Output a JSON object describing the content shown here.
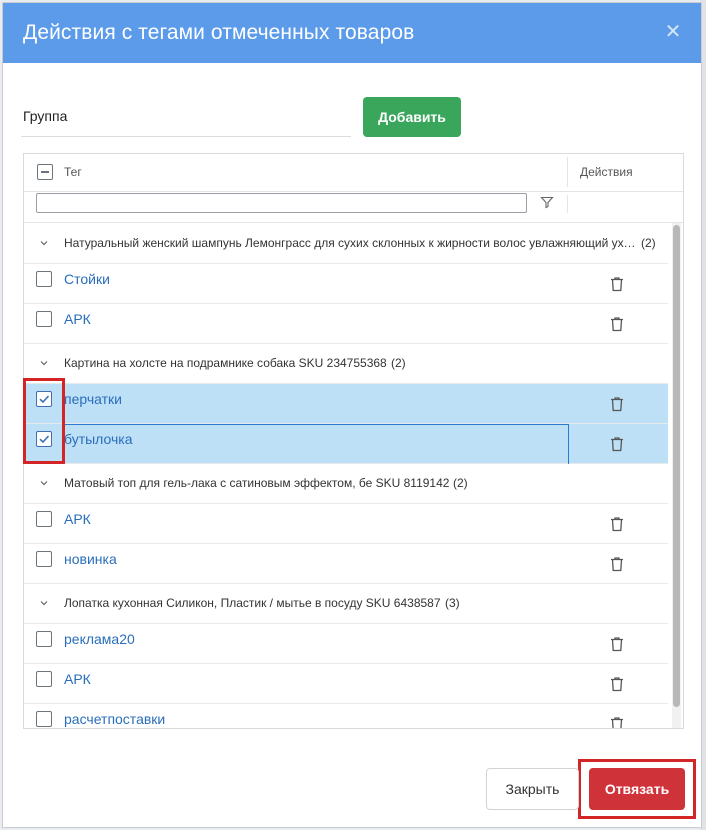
{
  "dialog": {
    "title": "Действия с тегами отмеченных товаров",
    "close_icon": "close-icon"
  },
  "group_input": {
    "value": "Группа",
    "placeholder": ""
  },
  "add_button": "Добавить",
  "table": {
    "header_tag": "Тег",
    "header_actions": "Действия",
    "filter_value": "",
    "groups": [
      {
        "title": "Натуральный женский шампунь Лемонграсс для сухих склонных к жирности волос увлажняющий ухо…",
        "count": "(2)",
        "rows": [
          {
            "tag": "Стойки",
            "checked": false
          },
          {
            "tag": "АРК",
            "checked": false
          }
        ]
      },
      {
        "title": "Картина на холсте на подрамнике собака SKU 234755368",
        "count": "(2)",
        "rows": [
          {
            "tag": "перчатки",
            "checked": true
          },
          {
            "tag": "бутылочка",
            "checked": true
          }
        ]
      },
      {
        "title": "Матовый топ для гель-лака с сатиновым эффектом, бе SKU 8119142",
        "count": "(2)",
        "rows": [
          {
            "tag": "АРК",
            "checked": false
          },
          {
            "tag": "новинка",
            "checked": false
          }
        ]
      },
      {
        "title": "Лопатка кухонная Силикон, Пластик / мытье в посуду SKU 6438587",
        "count": "(3)",
        "rows": [
          {
            "tag": "реклама20",
            "checked": false
          },
          {
            "tag": "АРК",
            "checked": false
          },
          {
            "tag": "расчетпоставки",
            "checked": false
          }
        ]
      }
    ]
  },
  "footer": {
    "close_button": "Закрыть",
    "unbind_button": "Отвязать"
  },
  "colors": {
    "header_bg": "#5b9bea",
    "add_button": "#3aa65c",
    "unbind_button": "#d0323a",
    "selected_row": "#bde0f7",
    "link": "#2a6ebb",
    "highlight": "#d32525"
  }
}
